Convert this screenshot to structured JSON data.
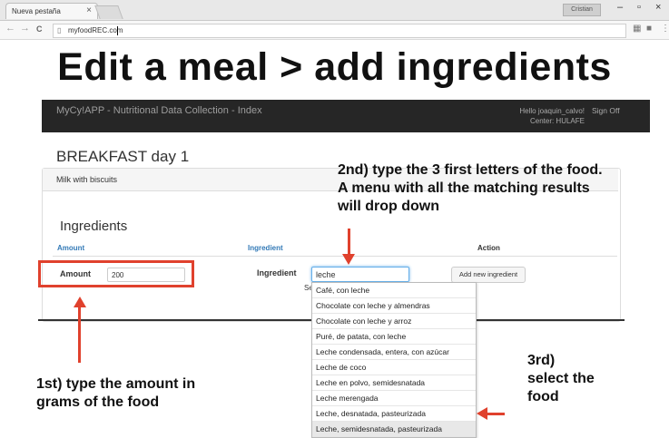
{
  "browser": {
    "tab_title": "Nueva pestaña",
    "tab_close": "×",
    "window_label": "Cristian",
    "min": "–",
    "max": "▫",
    "close": "×",
    "back": "←",
    "forward": "→",
    "reload": "C",
    "url": "myfoodREC.com"
  },
  "headline": "Edit a meal > add ingredients",
  "app": {
    "brand": "MyCy!APP - Nutritional Data Collection - Index",
    "hello_line1": "Hello joaquin_calvo!",
    "hello_line2": "Center: HULAFE",
    "signoff": "Sign Off"
  },
  "meal": {
    "title": "BREAKFAST day 1",
    "name": "Milk with biscuits"
  },
  "ingredients": {
    "heading": "Ingredients",
    "col_amount": "Amount",
    "col_ingredient": "Ingredient",
    "col_action": "Action",
    "amount_label": "Amount",
    "amount_value": "200",
    "ingredient_label": "Ingredient",
    "ingredient_value": "leche",
    "add_button": "Add new ingredient",
    "partial_text": "Se"
  },
  "dropdown": [
    "Café, con leche",
    "Chocolate con leche y almendras",
    "Chocolate con leche y arroz",
    "Puré, de patata, con leche",
    "Leche condensada, entera, con azúcar",
    "Leche de coco",
    "Leche en polvo, semidesnatada",
    "Leche merengada",
    "Leche, desnatada, pasteurizada",
    "Leche, semidesnatada, pasteurizada"
  ],
  "annotations": {
    "step2_l1": "2nd) type the 3 first letters of the food.",
    "step2_l2": "A menu with all the matching results",
    "step2_l3": "will drop down",
    "step1_l1": "1st) type the amount in",
    "step1_l2": "grams of the food",
    "step3_l1": "3rd)",
    "step3_l2": "select the",
    "step3_l3": "food"
  },
  "colors": {
    "annotation_red": "#e0412d",
    "navbar": "#262626",
    "link_blue": "#337ab7",
    "focus_blue": "#66afe9"
  }
}
